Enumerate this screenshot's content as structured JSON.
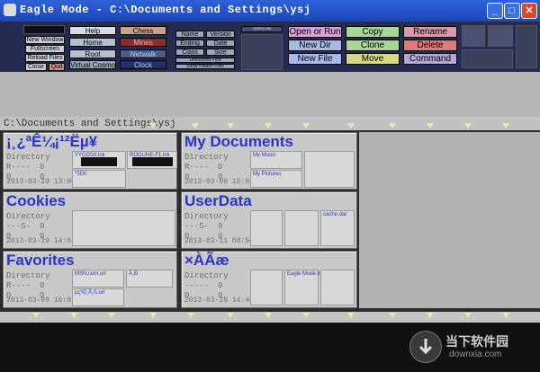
{
  "window": {
    "title": "Eagle Mode - C:\\Documents and Settings\\ysj",
    "min_label": "_",
    "max_label": "□",
    "close_label": "✕"
  },
  "panel": {
    "left_buttons": [
      "New Window",
      "Fullscreen",
      "Reload Files",
      "Close",
      "Quit"
    ],
    "nav_buttons": [
      "Help",
      "Home",
      "Root",
      "Virtual Cosmos"
    ],
    "red_buttons": [
      "Chess",
      "Mines",
      "Netwalk",
      "Clock"
    ],
    "sort_buttons": [
      "Name",
      "Version",
      "Ending",
      "Date",
      "Class",
      "Size"
    ],
    "dir_first": "Directories First",
    "show_hidden": "Show Hidden Files",
    "select_label": "Select All",
    "action_buttons": [
      "Open or Run",
      "Copy",
      "Rename",
      "New Dir",
      "Clone",
      "Delete",
      "New File",
      "Move",
      "Command"
    ]
  },
  "path": "C:\\Documents and Settings\\ysj",
  "tiles": [
    {
      "name": "¡¸¿ªÊ¼¡¹²Ëµ¥",
      "type": "Directory",
      "r": "R----",
      "s": "0",
      "n": "0",
      "date": "2013-03-29 13:06:56",
      "files": [
        "YYGDS0.lnk",
        "ROGUNE-F1.lnk",
        "*3D0"
      ]
    },
    {
      "name": "My Documents",
      "type": "Directory",
      "r": "R----",
      "s": "0",
      "n": "0",
      "date": "2013-03-09 16:01:55",
      "files": [
        "My Music",
        "My Pictures"
      ]
    },
    {
      "name": "Cookies",
      "type": "Directory",
      "r": "---S-",
      "s": "0",
      "n": "0",
      "date": "2013-03-29 14:07:21",
      "files": []
    },
    {
      "name": "UserData",
      "type": "Directory",
      "r": "---S-",
      "s": "0",
      "n": "0",
      "date": "2013-03-11 08:50:44",
      "files": [
        "cache.dat"
      ]
    },
    {
      "name": "Favorites",
      "type": "Directory",
      "r": "R----",
      "s": "0",
      "n": "0",
      "date": "2013-03-09 16:01:57",
      "files": [
        "MSN.com.url",
        "µç³Ö¸Â¸ß.url",
        "Ã¸Ð"
      ]
    },
    {
      "name": "×ÀÃæ",
      "type": "Directory",
      "r": "-----",
      "s": "0",
      "n": "0",
      "date": "2013-03-29 14:48:15",
      "files": [
        "Eagle Mode.lnk"
      ]
    }
  ],
  "watermark": {
    "text": "当下软件园",
    "url": "downxia.com"
  },
  "colors": {
    "title_blue": "#2a35c4",
    "panel_bg": "#252c4f"
  }
}
